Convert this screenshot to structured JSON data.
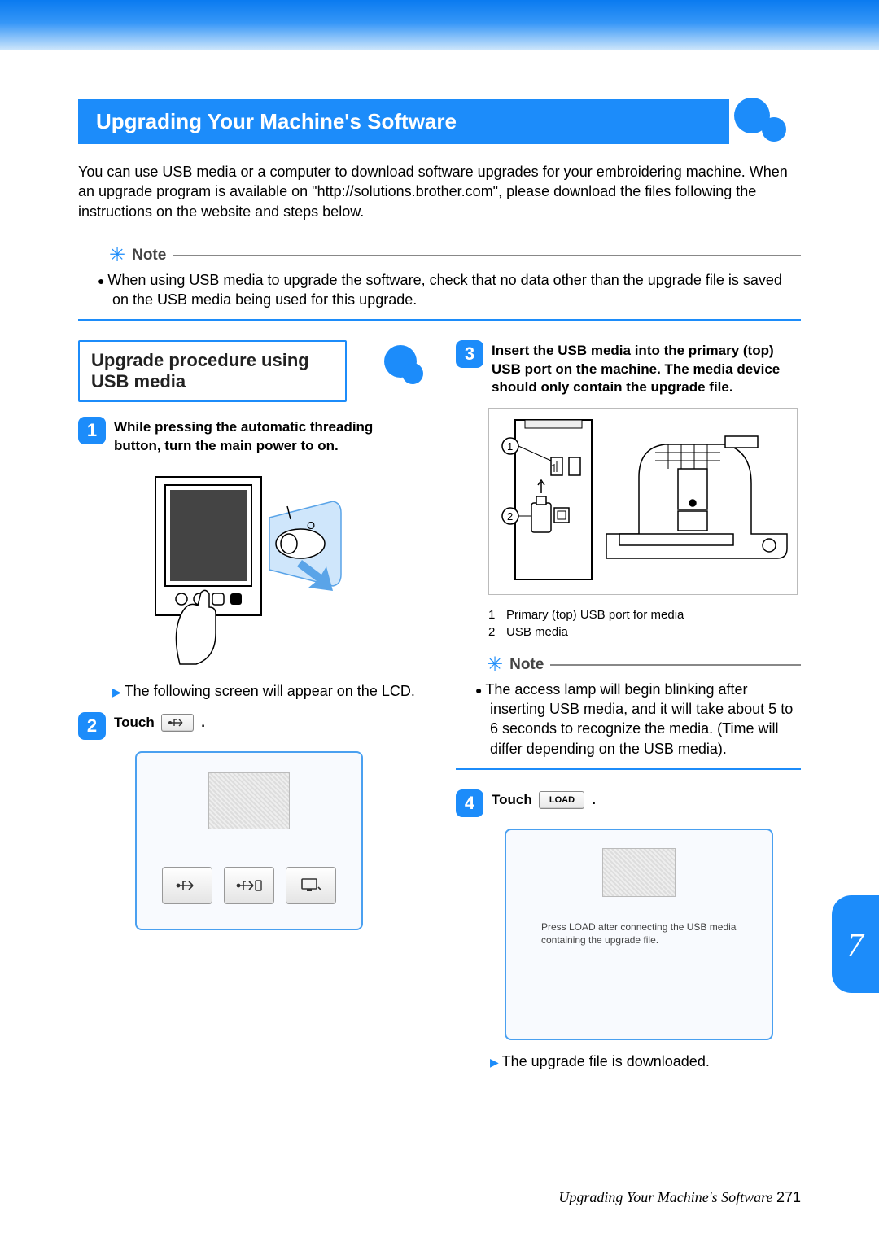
{
  "header_bar": {},
  "main_title": "Upgrading Your Machine's Software",
  "intro": "You can use USB media or a computer to download software upgrades for your embroidering machine. When an upgrade program is available on \"http://solutions.brother.com\", please download the files following the instructions on the website and steps below.",
  "note1": {
    "label": "Note",
    "body": "When using USB media to upgrade the software, check that no data other than the upgrade file is saved on the USB media being used for this upgrade."
  },
  "sub_title": "Upgrade procedure using USB media",
  "left": {
    "step1": {
      "num": "1",
      "text": "While pressing the automatic threading button, turn the main power to on."
    },
    "arrow1": "The following screen will appear on the LCD.",
    "step2": {
      "num": "2",
      "text_before": "Touch",
      "button_glyph": "⎋",
      "text_after": "."
    },
    "lcd_buttons": {
      "b1": "⎋",
      "b2": "⎋⁺",
      "b3": "⧉"
    }
  },
  "right": {
    "step3": {
      "num": "3",
      "text": "Insert the USB media into the primary (top) USB port on the machine. The media device should only contain the upgrade file."
    },
    "callouts": {
      "c1_num": "1",
      "c1_text": "Primary (top) USB port for media",
      "c2_num": "2",
      "c2_text": "USB media"
    },
    "note2": {
      "label": "Note",
      "body": "The access lamp will begin blinking after inserting USB media, and it will take about 5 to 6 seconds to recognize the media. (Time will differ depending on the USB media)."
    },
    "step4": {
      "num": "4",
      "text_before": "Touch",
      "button_label": "LOAD",
      "text_after": "."
    },
    "lcd_msg": "Press LOAD after connecting the USB media containing the upgrade file.",
    "arrow2": "The upgrade file is downloaded."
  },
  "side_tab": "7",
  "footer": {
    "title": "Upgrading Your Machine's Software",
    "page": "271"
  }
}
